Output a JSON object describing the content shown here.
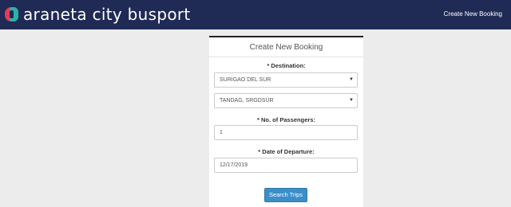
{
  "navbar": {
    "brand": "araneta city busport",
    "create_link": "Create New Booking"
  },
  "card": {
    "title": "Create New Booking",
    "destination_label": "* Destination:",
    "destination_value": "SURIGAO DEL SUR",
    "terminal_value": "TANDAG, SRGDSUR",
    "passengers_label": "* No. of Passengers:",
    "passengers_value": "1",
    "date_label": "* Date of Departure:",
    "date_value": "12/17/2019",
    "search_button": "Search Trips"
  },
  "icons": {
    "caret": "caret-down-icon"
  },
  "colors": {
    "navbar_bg": "#1f2a55",
    "button_bg": "#3a8fc8",
    "page_bg": "#ececec"
  }
}
